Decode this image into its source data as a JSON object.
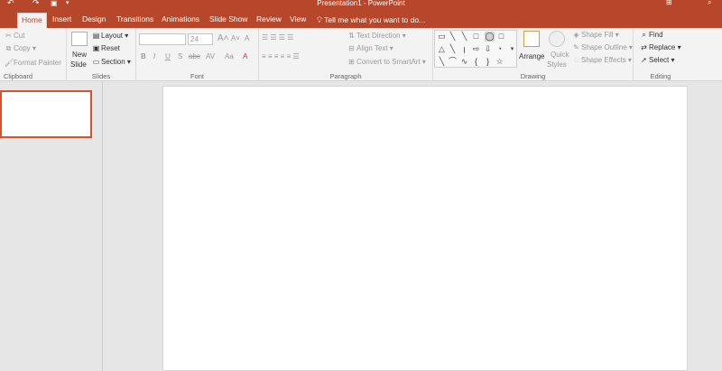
{
  "window": {
    "title": "Presentation1 - PowerPoint"
  },
  "quick_access": {
    "undo": "↶",
    "redo": "↷",
    "more": "▾"
  },
  "tabs": [
    {
      "label": "Home",
      "active": true
    },
    {
      "label": "Insert"
    },
    {
      "label": "Design"
    },
    {
      "label": "Transitions"
    },
    {
      "label": "Animations"
    },
    {
      "label": "Slide Show"
    },
    {
      "label": "Review"
    },
    {
      "label": "View"
    }
  ],
  "tell_me": {
    "icon": "lightbulb-icon",
    "text": "Tell me what you want to do..."
  },
  "clipboard": {
    "cut": "Cut",
    "copy": "Copy",
    "format_painter": "Format Painter",
    "group": "Clipboard"
  },
  "slides": {
    "new_slide_1": "New",
    "new_slide_2": "Slide",
    "layout": "Layout",
    "reset": "Reset",
    "section": "Section",
    "group": "Slides"
  },
  "font": {
    "size": "24",
    "bold": "B",
    "italic": "I",
    "underline": "U",
    "strike": "S",
    "shadow": "abc",
    "spacing": "AV",
    "case": "Aa",
    "grow": "A",
    "shrink": "A",
    "clear": "A",
    "group": "Font"
  },
  "paragraph": {
    "text_direction": "Text Direction",
    "align_text": "Align Text",
    "smartart": "Convert to SmartArt",
    "group": "Paragraph"
  },
  "drawing": {
    "arrange": "Arrange",
    "quick_styles_1": "Quick",
    "quick_styles_2": "Styles",
    "shape_fill": "Shape Fill",
    "shape_outline": "Shape Outline",
    "shape_effects": "Shape Effects",
    "group": "Drawing"
  },
  "editing": {
    "find": "Find",
    "replace": "Replace",
    "select": "Select",
    "group": "Editing"
  },
  "colors": {
    "accent": "#b7472a",
    "thumb_border": "#d35230"
  }
}
